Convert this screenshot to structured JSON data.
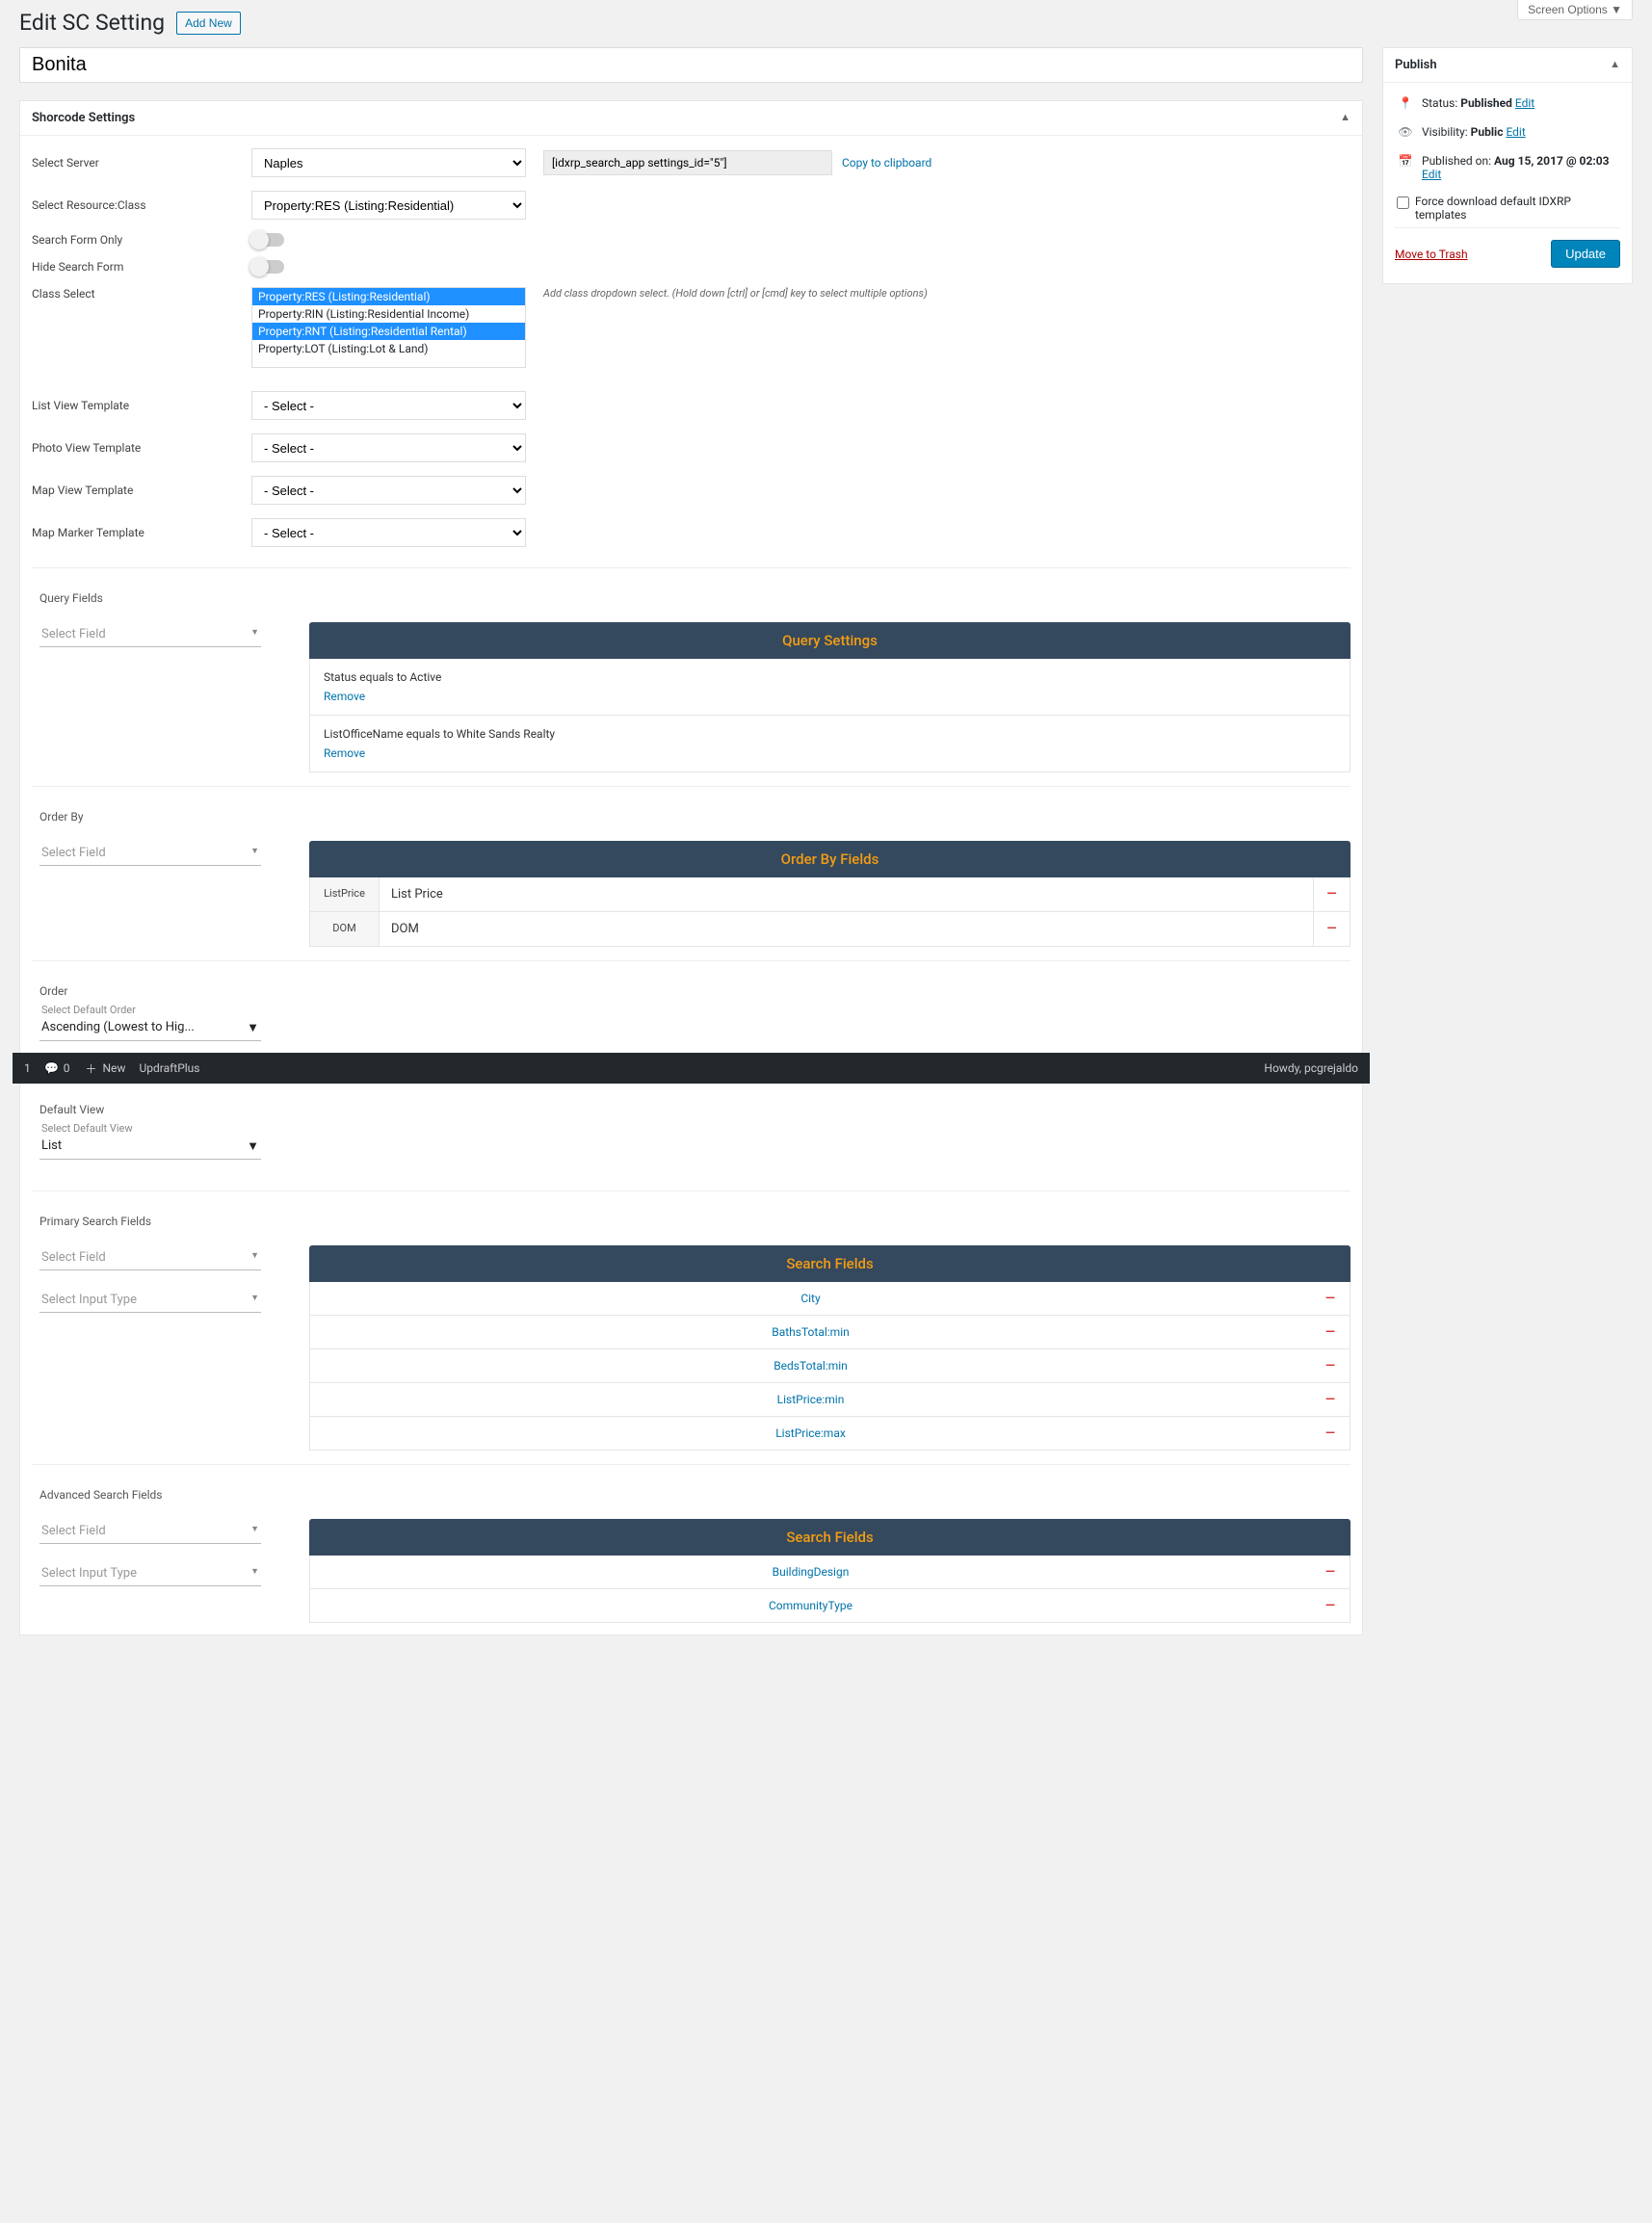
{
  "screen_options": "Screen Options ▼",
  "page_title": "Edit SC Setting",
  "add_new": "Add New",
  "post_title": "Bonita",
  "metabox_title": "Shorcode Settings",
  "form": {
    "select_server_label": "Select Server",
    "select_server_value": "Naples",
    "resource_class_label": "Select Resource:Class",
    "resource_class_value": "Property:RES (Listing:Residential)",
    "search_form_only_label": "Search Form Only",
    "hide_search_form_label": "Hide Search Form",
    "class_select_label": "Class Select",
    "class_options": [
      "Property:RES (Listing:Residential)",
      "Property:RIN (Listing:Residential Income)",
      "Property:RNT (Listing:Residential Rental)",
      "Property:LOT (Listing:Lot & Land)"
    ],
    "class_select_hint": "Add class dropdown select. (Hold down [ctrl] or [cmd] key to select multiple options)",
    "list_view_label": "List View Template",
    "photo_view_label": "Photo View Template",
    "map_view_label": "Map View Template",
    "marker_label": "Map Marker Template",
    "select_placeholder": "- Select -"
  },
  "shortcode_value": "[idxrp_search_app settings_id=\"5\"]",
  "copy_label": "Copy to clipboard",
  "query_fields": {
    "header": "Query Fields",
    "left_placeholder": "Select Field",
    "banner": "Query Settings",
    "items": [
      {
        "label": "Status equals to Active"
      },
      {
        "label": "ListOfficeName equals to White Sands Realty"
      }
    ],
    "remove": "Remove"
  },
  "order_by": {
    "header": "Order By",
    "left_placeholder": "Select Field",
    "banner": "Order By Fields",
    "rows": [
      {
        "key": "ListPrice",
        "label": "List Price"
      },
      {
        "key": "DOM",
        "label": "DOM"
      }
    ]
  },
  "order": {
    "header": "Order",
    "sub_label": "Select Default Order",
    "value": "Ascending (Lowest to Hig..."
  },
  "adminbar": {
    "badge": "1",
    "comments": "0",
    "new": "New",
    "updraft": "UpdraftPlus",
    "howdy": "Howdy, pcgrejaldo"
  },
  "default_view": {
    "header": "Default View",
    "sub_label": "Select Default View",
    "value": "List"
  },
  "primary_search": {
    "header": "Primary Search Fields",
    "left_field": "Select Field",
    "left_type": "Select Input Type",
    "banner": "Search Fields",
    "items": [
      "City",
      "BathsTotal:min",
      "BedsTotal:min",
      "ListPrice:min",
      "ListPrice:max"
    ]
  },
  "advanced_search": {
    "header": "Advanced Search Fields",
    "left_field": "Select Field",
    "left_type": "Select Input Type",
    "banner": "Search Fields",
    "items": [
      "BuildingDesign",
      "CommunityType"
    ]
  },
  "publish": {
    "title": "Publish",
    "status_label": "Status:",
    "status_value": "Published",
    "visibility_label": "Visibility:",
    "visibility_value": "Public",
    "pub_label": "Published on:",
    "pub_value": "Aug 15, 2017 @ 02:03",
    "edit": "Edit",
    "force_dl": "Force download default IDXRP templates",
    "trash": "Move to Trash",
    "update": "Update"
  }
}
